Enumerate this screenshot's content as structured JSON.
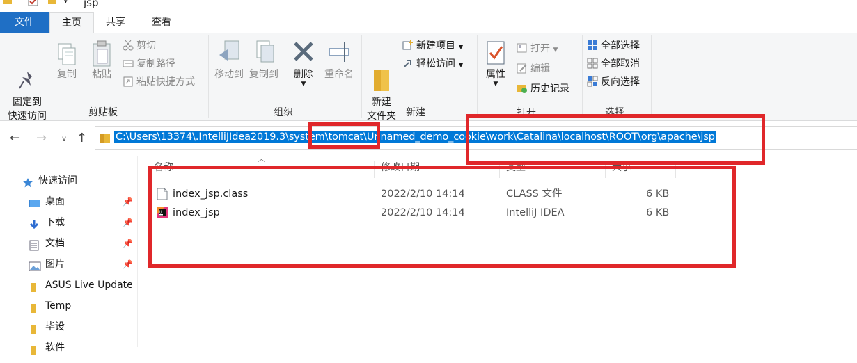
{
  "window": {
    "title": "jsp"
  },
  "tabs": [
    "文件",
    "主页",
    "共享",
    "查看"
  ],
  "ribbon": {
    "clipboard": {
      "pin": "固定到\n快速访问",
      "copy": "复制",
      "paste": "粘贴",
      "cut": "剪切",
      "copy_path": "复制路径",
      "paste_shortcut": "粘贴快捷方式",
      "label": "剪贴板"
    },
    "organize": {
      "move_to": "移动到",
      "copy_to": "复制到",
      "delete": "删除",
      "rename": "重命名",
      "label": "组织"
    },
    "new": {
      "new_folder": "新建\n文件夹",
      "new_item": "新建项目",
      "easy_access": "轻松访问",
      "label": "新建"
    },
    "open": {
      "properties": "属性",
      "open": "打开",
      "edit": "编辑",
      "history": "历史记录",
      "label": "打开"
    },
    "select": {
      "select_all": "全部选择",
      "select_none": "全部取消",
      "invert": "反向选择",
      "label": "选择"
    }
  },
  "address": {
    "path": "C:\\Users\\13374\\.IntelliJIdea2019.3\\system\\tomcat\\Unnamed_demo_cookie\\work\\Catalina\\localhost\\ROOT\\org\\apache\\jsp"
  },
  "sidebar": {
    "items": [
      {
        "label": "快速访问",
        "icon": "star-icon",
        "pinned": false
      },
      {
        "label": "桌面",
        "icon": "desktop-icon",
        "pinned": true
      },
      {
        "label": "下载",
        "icon": "download-icon",
        "pinned": true
      },
      {
        "label": "文档",
        "icon": "document-icon",
        "pinned": true
      },
      {
        "label": "图片",
        "icon": "picture-icon",
        "pinned": true
      },
      {
        "label": "ASUS Live Update",
        "icon": "folder-icon",
        "pinned": false
      },
      {
        "label": "Temp",
        "icon": "folder-icon",
        "pinned": false
      },
      {
        "label": "毕设",
        "icon": "folder-icon",
        "pinned": false
      },
      {
        "label": "软件",
        "icon": "folder-icon",
        "pinned": false
      }
    ]
  },
  "columns": [
    "名称",
    "修改日期",
    "类型",
    "大小"
  ],
  "files": [
    {
      "name": "index_jsp.class",
      "date": "2022/2/10 14:14",
      "type": "CLASS 文件",
      "size": "6 KB",
      "icon": "file-icon"
    },
    {
      "name": "index_jsp",
      "date": "2022/2/10 14:14",
      "type": "IntelliJ IDEA",
      "size": "6 KB",
      "icon": "intellij-icon"
    }
  ],
  "colors": {
    "accent": "#1f6fc5",
    "selection": "#0078d7",
    "annotation": "#e0272a"
  }
}
